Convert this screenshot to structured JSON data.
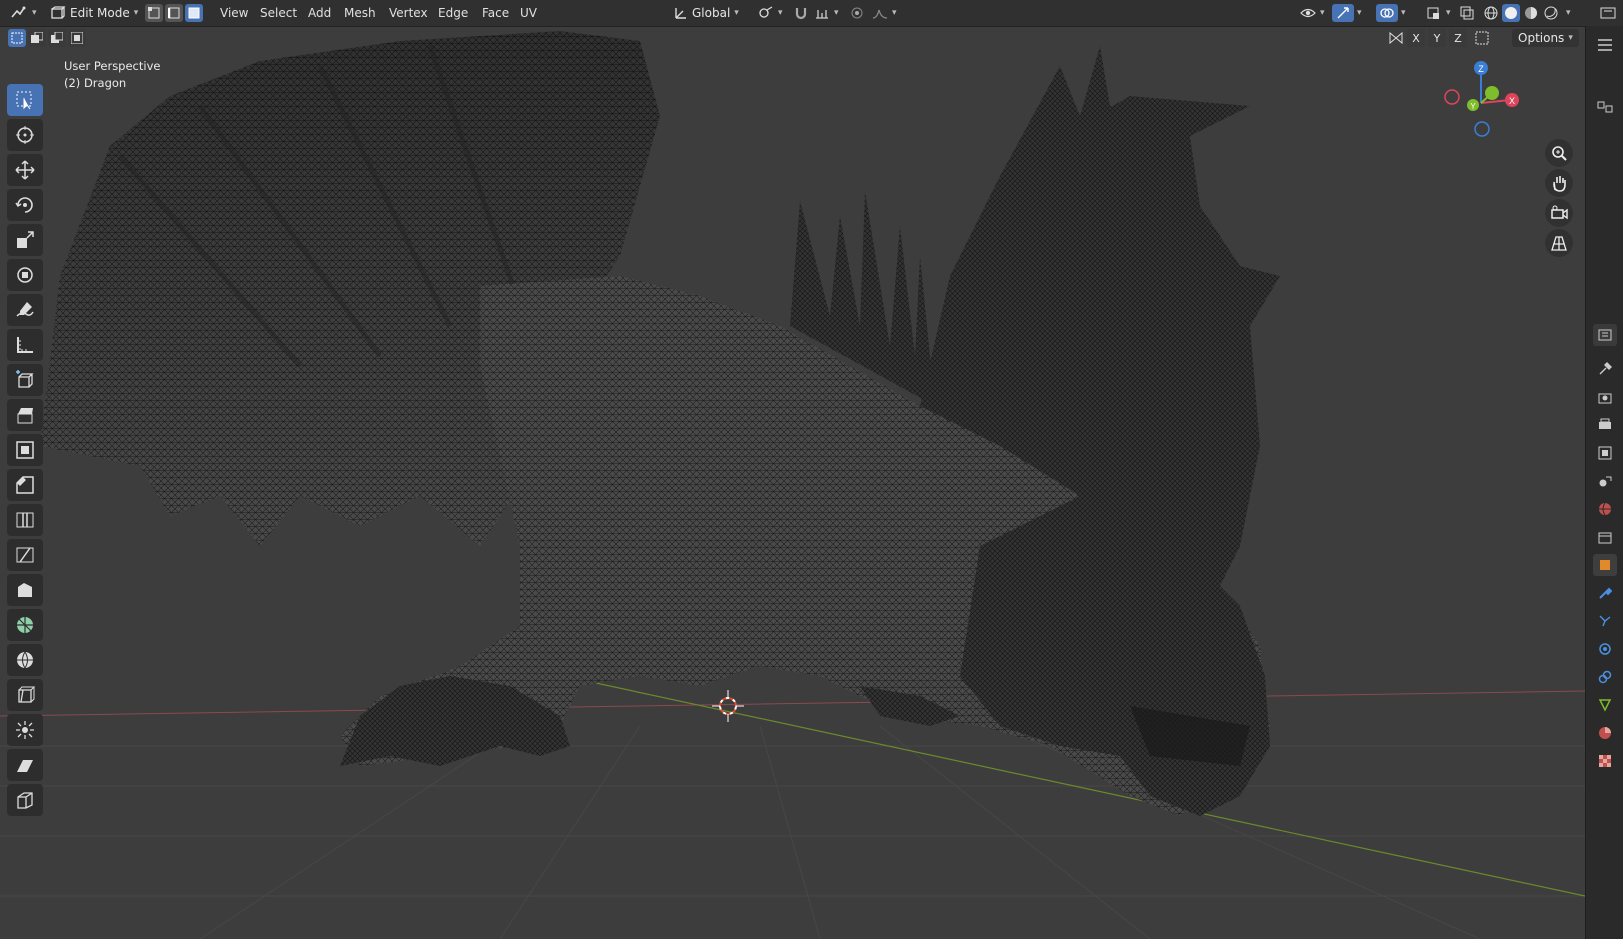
{
  "header": {
    "mode": "Edit Mode",
    "menus": [
      "View",
      "Select",
      "Add",
      "Mesh",
      "Vertex",
      "Edge",
      "Face",
      "UV"
    ],
    "orientation": "Global",
    "options_label": "Options",
    "axis_labels": [
      "X",
      "Y",
      "Z"
    ]
  },
  "viewport": {
    "perspective_label": "User Perspective",
    "object_label": "(2) Dragon"
  },
  "gizmo": {
    "x": "X",
    "y": "Y",
    "z": "Z"
  },
  "colors": {
    "accent": "#4772b3",
    "axis_x": "#e0445a",
    "axis_y": "#7ebd2c",
    "axis_z": "#3b7ed6",
    "grid_bg": "#3d3d3d",
    "header_bg": "#303030"
  },
  "toolbar_icons": [
    "select-box-icon",
    "cursor-icon",
    "move-icon",
    "rotate-icon",
    "scale-icon",
    "transform-icon",
    "annotate-icon",
    "measure-icon",
    "add-cube-icon",
    "extrude-icon",
    "inset-icon",
    "bevel-icon",
    "loop-cut-icon",
    "knife-icon",
    "poly-build-icon",
    "spin-icon",
    "smooth-icon",
    "edge-slide-icon",
    "shrink-fatten-icon",
    "shear-icon",
    "rip-region-icon"
  ],
  "properties_icons": [
    "tool-icon",
    "render-icon",
    "output-icon",
    "view-layer-icon",
    "scene-icon",
    "world-icon",
    "collection-icon",
    "object-icon",
    "modifier-icon",
    "particles-icon",
    "physics-icon",
    "constraints-icon",
    "data-icon",
    "material-icon",
    "texture-icon"
  ]
}
